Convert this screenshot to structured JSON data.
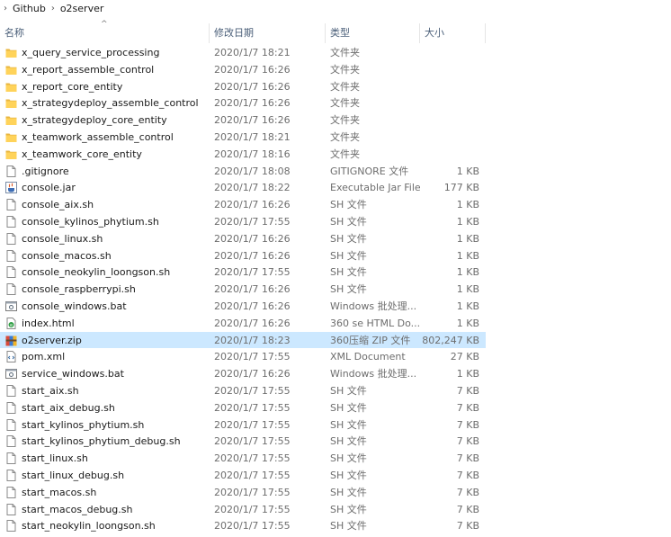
{
  "breadcrumb": {
    "items": [
      "Github",
      "o2server"
    ],
    "separator": "›"
  },
  "columns": {
    "name": "名称",
    "modified": "修改日期",
    "type": "类型",
    "size": "大小"
  },
  "files": [
    {
      "name": "x_query_service_processing",
      "modified": "2020/1/7 18:21",
      "type": "文件夹",
      "size": "",
      "icon": "folder-icon"
    },
    {
      "name": "x_report_assemble_control",
      "modified": "2020/1/7 16:26",
      "type": "文件夹",
      "size": "",
      "icon": "folder-icon"
    },
    {
      "name": "x_report_core_entity",
      "modified": "2020/1/7 16:26",
      "type": "文件夹",
      "size": "",
      "icon": "folder-icon"
    },
    {
      "name": "x_strategydeploy_assemble_control",
      "modified": "2020/1/7 16:26",
      "type": "文件夹",
      "size": "",
      "icon": "folder-icon"
    },
    {
      "name": "x_strategydeploy_core_entity",
      "modified": "2020/1/7 16:26",
      "type": "文件夹",
      "size": "",
      "icon": "folder-icon"
    },
    {
      "name": "x_teamwork_assemble_control",
      "modified": "2020/1/7 18:21",
      "type": "文件夹",
      "size": "",
      "icon": "folder-icon"
    },
    {
      "name": "x_teamwork_core_entity",
      "modified": "2020/1/7 18:16",
      "type": "文件夹",
      "size": "",
      "icon": "folder-icon"
    },
    {
      "name": ".gitignore",
      "modified": "2020/1/7 18:08",
      "type": "GITIGNORE 文件",
      "size": "1 KB",
      "icon": "file-icon"
    },
    {
      "name": "console.jar",
      "modified": "2020/1/7 18:22",
      "type": "Executable Jar File",
      "size": "177 KB",
      "icon": "jar-icon"
    },
    {
      "name": "console_aix.sh",
      "modified": "2020/1/7 16:26",
      "type": "SH 文件",
      "size": "1 KB",
      "icon": "file-icon"
    },
    {
      "name": "console_kylinos_phytium.sh",
      "modified": "2020/1/7 17:55",
      "type": "SH 文件",
      "size": "1 KB",
      "icon": "file-icon"
    },
    {
      "name": "console_linux.sh",
      "modified": "2020/1/7 16:26",
      "type": "SH 文件",
      "size": "1 KB",
      "icon": "file-icon"
    },
    {
      "name": "console_macos.sh",
      "modified": "2020/1/7 16:26",
      "type": "SH 文件",
      "size": "1 KB",
      "icon": "file-icon"
    },
    {
      "name": "console_neokylin_loongson.sh",
      "modified": "2020/1/7 17:55",
      "type": "SH 文件",
      "size": "1 KB",
      "icon": "file-icon"
    },
    {
      "name": "console_raspberrypi.sh",
      "modified": "2020/1/7 16:26",
      "type": "SH 文件",
      "size": "1 KB",
      "icon": "file-icon"
    },
    {
      "name": "console_windows.bat",
      "modified": "2020/1/7 16:26",
      "type": "Windows 批处理...",
      "size": "1 KB",
      "icon": "bat-icon"
    },
    {
      "name": "index.html",
      "modified": "2020/1/7 16:26",
      "type": "360 se HTML Do...",
      "size": "1 KB",
      "icon": "html-icon"
    },
    {
      "name": "o2server.zip",
      "modified": "2020/1/7 18:23",
      "type": "360压缩 ZIP 文件",
      "size": "802,247 KB",
      "icon": "zip-icon",
      "selected": true
    },
    {
      "name": "pom.xml",
      "modified": "2020/1/7 17:55",
      "type": "XML Document",
      "size": "27 KB",
      "icon": "xml-icon"
    },
    {
      "name": "service_windows.bat",
      "modified": "2020/1/7 16:26",
      "type": "Windows 批处理...",
      "size": "1 KB",
      "icon": "bat-icon"
    },
    {
      "name": "start_aix.sh",
      "modified": "2020/1/7 17:55",
      "type": "SH 文件",
      "size": "7 KB",
      "icon": "file-icon"
    },
    {
      "name": "start_aix_debug.sh",
      "modified": "2020/1/7 17:55",
      "type": "SH 文件",
      "size": "7 KB",
      "icon": "file-icon"
    },
    {
      "name": "start_kylinos_phytium.sh",
      "modified": "2020/1/7 17:55",
      "type": "SH 文件",
      "size": "7 KB",
      "icon": "file-icon"
    },
    {
      "name": "start_kylinos_phytium_debug.sh",
      "modified": "2020/1/7 17:55",
      "type": "SH 文件",
      "size": "7 KB",
      "icon": "file-icon"
    },
    {
      "name": "start_linux.sh",
      "modified": "2020/1/7 17:55",
      "type": "SH 文件",
      "size": "7 KB",
      "icon": "file-icon"
    },
    {
      "name": "start_linux_debug.sh",
      "modified": "2020/1/7 17:55",
      "type": "SH 文件",
      "size": "7 KB",
      "icon": "file-icon"
    },
    {
      "name": "start_macos.sh",
      "modified": "2020/1/7 17:55",
      "type": "SH 文件",
      "size": "7 KB",
      "icon": "file-icon"
    },
    {
      "name": "start_macos_debug.sh",
      "modified": "2020/1/7 17:55",
      "type": "SH 文件",
      "size": "7 KB",
      "icon": "file-icon"
    },
    {
      "name": "start_neokylin_loongson.sh",
      "modified": "2020/1/7 17:55",
      "type": "SH 文件",
      "size": "7 KB",
      "icon": "file-icon"
    }
  ]
}
